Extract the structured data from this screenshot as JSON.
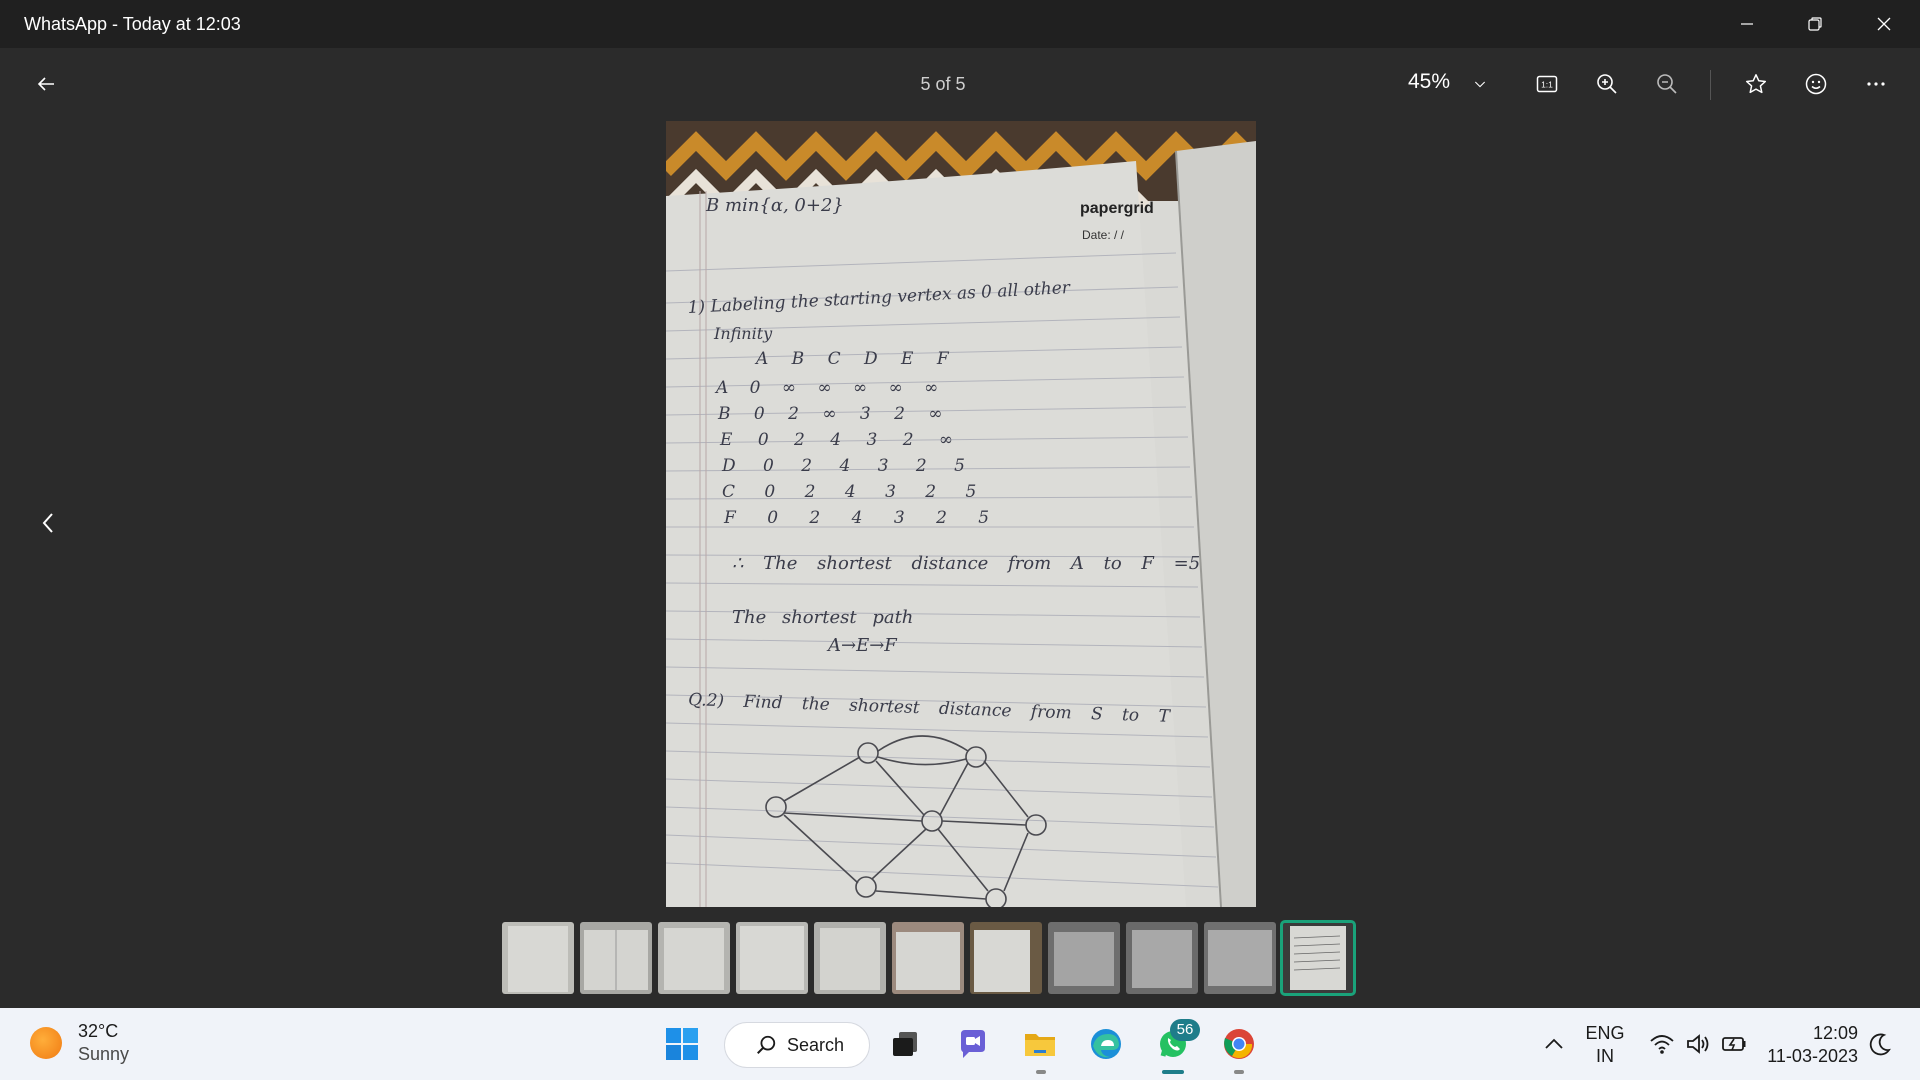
{
  "window": {
    "title": "WhatsApp - Today at 12:03",
    "minimize_icon": "minimize-icon",
    "restore_icon": "restore-icon",
    "close_icon": "close-icon"
  },
  "toolbar": {
    "back_icon": "arrow-left-icon",
    "page_counter": "5 of 5",
    "zoom_level": "45%",
    "zoom_dropdown_icon": "chevron-down-icon",
    "actual_size_icon": "actual-size-icon",
    "actual_size_label": "1:1",
    "zoom_in_icon": "zoom-in-icon",
    "zoom_out_icon": "zoom-out-icon",
    "favorite_icon": "star-icon",
    "react_icon": "smiley-icon",
    "more_icon": "more-icon"
  },
  "viewer": {
    "prev_icon": "chevron-left-icon",
    "photo": {
      "brand": "papergrid",
      "date_label": "Date: / /",
      "lines": [
        "B min{α, 0+2}",
        "1) Labeling the starting vertex as 0 all other",
        "Infinity",
        "A B C D E F",
        "A 0 ∞ ∞ ∞ ∞ ∞",
        "B 0 2 ∞ 3 2 ∞",
        "E 0 2 4 3 2 ∞",
        "D 0 2 4 3 2 5",
        "C 0 2 4 3 2 5",
        "F 0 2 4 3 2 5",
        "∴ The shortest distance from A to F =5",
        "The shortest path",
        "A→E→F",
        "Q.2) Find the shortest distance from S to T"
      ]
    }
  },
  "filmstrip": {
    "thumbnails": 11,
    "active_index": 10
  },
  "taskbar": {
    "weather": {
      "temp": "32°C",
      "condition": "Sunny"
    },
    "search_label": "Search",
    "apps": [
      "windows-start",
      "search",
      "task-view",
      "teams-chat",
      "file-explorer",
      "edge",
      "whatsapp",
      "chrome"
    ],
    "whatsapp_badge": "56",
    "language": {
      "line1": "ENG",
      "line2": "IN"
    },
    "clock": {
      "time": "12:09",
      "date": "11-03-2023"
    },
    "colors": {
      "accent": "#1aa27a",
      "taskbar_bg": "#f0f3f9",
      "viewer_bg": "#2b2b2b"
    }
  }
}
